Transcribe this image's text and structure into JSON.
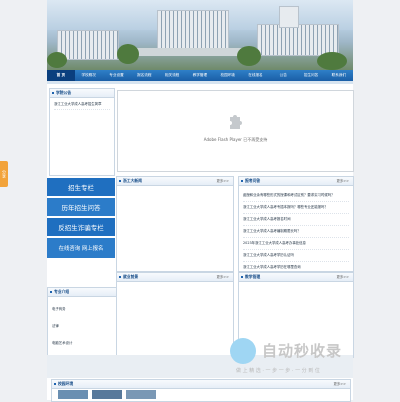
{
  "nav": [
    "首 页",
    "学校概况",
    "专业设置",
    "报名流程",
    "相关流程",
    "教学管理",
    "校园环境",
    "在线报名",
    "公告",
    "招生问答",
    "联系我们"
  ],
  "side_tab": "分享",
  "notice": {
    "title": "学院公告",
    "items": [
      "浙江工业大学成人高考招生简章"
    ]
  },
  "left_buttons": [
    "招生专栏",
    "历年招生问答",
    "反招生诈骗专栏",
    "在线咨询   网上报名"
  ],
  "majors": {
    "title": "专业介绍",
    "items": [
      "电子商务",
      "法律",
      "电脑艺术设计"
    ]
  },
  "flash": {
    "message": "Adobe Flash Player 已不再受支持"
  },
  "news": {
    "title": "浙工大新闻",
    "more": "更多>>"
  },
  "faq": {
    "title": "报考问答",
    "more": "更多>>",
    "items": [
      "函授和业余有哪些形式的授课和考试区别？要求实习时候吗？",
      "浙江工业大学成人高考专插本报吗？哪些专业还能报吗？",
      "浙江工业大学成人高考报名时间",
      "浙江工业大学成人高考编制期限长吗？",
      "2023年浙江工业大学成人高考办事处信息",
      "浙江工业大学成人高考学历认证吗",
      "浙江工业大学成人高考学历在哪里查询"
    ]
  },
  "enroll": {
    "title": "就业前景",
    "more": "更多>>"
  },
  "teach": {
    "title": "教学管理",
    "more": "更多>>"
  },
  "campus": {
    "title": "校园环境",
    "more": "更多>>"
  },
  "watermark": {
    "title": "自动秒收录",
    "sub": "做 上 精 选 · 一 步 一 步 · 一 分 到 位"
  }
}
